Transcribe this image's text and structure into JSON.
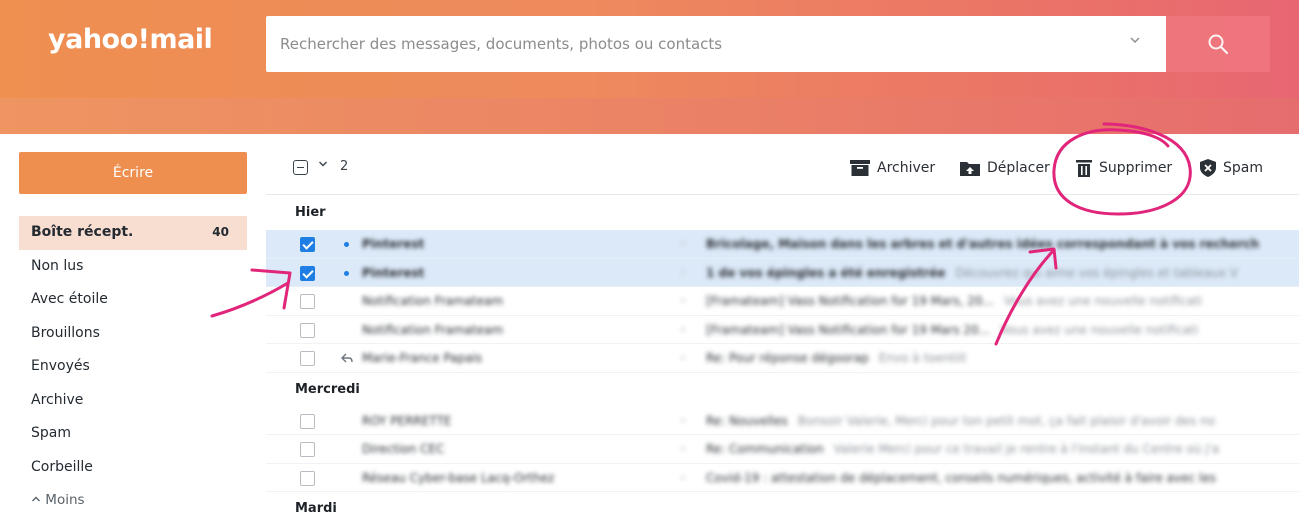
{
  "app": {
    "logo_text": "yahoo!mail"
  },
  "search": {
    "placeholder": "Rechercher des messages, documents, photos ou contacts",
    "dropdown_icon": "chevron-down-icon",
    "button_icon": "search-icon"
  },
  "colors": {
    "header_start": "#ef8f50",
    "header_end": "#e86673",
    "compose_bg": "#ee8f4f",
    "selected_row": "#dce9f8",
    "checkbox_checked": "#1f7ee3",
    "annotation": "#e0257a"
  },
  "sidebar": {
    "compose_label": "Écrire",
    "folders": [
      {
        "label": "Boîte récept.",
        "count": "40",
        "active": true
      },
      {
        "label": "Non lus"
      },
      {
        "label": "Avec étoile"
      },
      {
        "label": "Brouillons"
      },
      {
        "label": "Envoyés"
      },
      {
        "label": "Archive"
      },
      {
        "label": "Spam"
      },
      {
        "label": "Corbeille"
      }
    ],
    "less_label": "Moins",
    "less_icon": "chevron-up-icon"
  },
  "toolbar": {
    "selected_count": "2",
    "archive_label": "Archiver",
    "move_label": "Déplacer",
    "delete_label": "Supprimer",
    "spam_label": "Spam"
  },
  "messages": {
    "groups": [
      {
        "label": "Hier",
        "rows": [
          {
            "sender": "Pinterest",
            "subject": "Bricolage, Maison dans les arbres et d'autres idées correspondant à vos recherch",
            "snippet": "",
            "checked": true,
            "unread": true
          },
          {
            "sender": "Pinterest",
            "subject": "1 de vos épingles a été enregistrée",
            "snippet": "Découvrez qui aime vos épingles et tableaux V",
            "checked": true,
            "unread": true
          },
          {
            "sender": "Notification Framateam",
            "subject": "[Framateam] Vass Notification for 19 Mars, 20...",
            "snippet": "Vous avez une nouvelle notificati",
            "checked": false,
            "unread": false
          },
          {
            "sender": "Notification Framateam",
            "subject": "[Framateam] Vass Notification for 19 Mars 20...",
            "snippet": "Vous avez une nouvelle notificati",
            "checked": false,
            "unread": false
          },
          {
            "sender": "Marie-France Papais",
            "subject": "Re: Pour réponse dégoorap",
            "snippet": "Envo à toentiit",
            "checked": false,
            "unread": false,
            "replied": true
          }
        ]
      },
      {
        "label": "Mercredi",
        "rows": [
          {
            "sender": "ROY PERRETTE",
            "subject": "Re: Nouvelles",
            "snippet": "Bonsoir Valerie, Merci pour ton petit mot, ça fait plaisir d'avoir des no",
            "checked": false,
            "unread": false
          },
          {
            "sender": "Direction CEC",
            "subject": "Re: Communication",
            "snippet": "Valerie Merci pour ce travail je rentre à l'instant du Centre où j'a",
            "checked": false,
            "unread": false
          },
          {
            "sender": "Réseau Cyber-base Lacq-Orthez",
            "subject": "Covid-19 : attestation de déplacement, conseils numériques, activité à faire avec les",
            "snippet": "",
            "checked": false,
            "unread": false
          }
        ]
      },
      {
        "label": "Mardi",
        "rows": []
      }
    ]
  }
}
